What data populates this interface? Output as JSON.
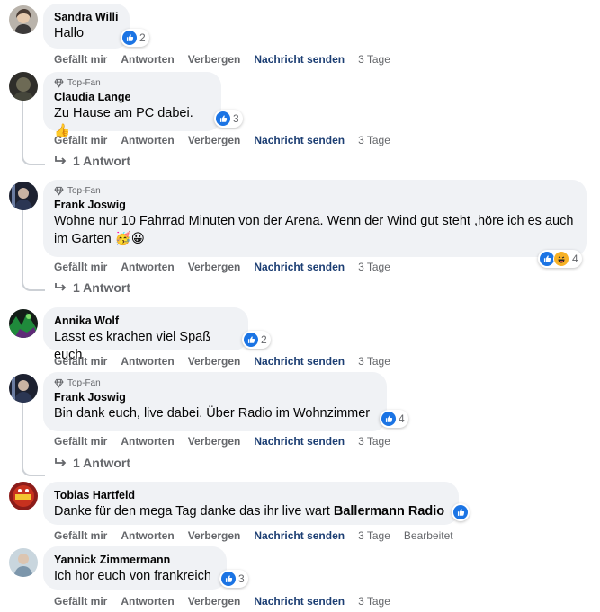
{
  "actions": {
    "like": "Gefällt mir",
    "reply": "Antworten",
    "hide": "Verbergen",
    "message": "Nachricht senden"
  },
  "badge": {
    "top_fan": "Top-Fan"
  },
  "colors": {
    "bubble": "#f0f2f5",
    "like_blue": "#1b74e4",
    "send_link": "#1c3e73",
    "muted": "#65676b"
  },
  "comments": [
    {
      "author": "Sandra Willi",
      "text": "Hallo",
      "reactions": "2",
      "time": "3 Tage",
      "top_fan": false,
      "reaction_icons": [
        "like-icon"
      ]
    },
    {
      "author": "Claudia Lange",
      "text": "Zu Hause am PC dabei. 👍",
      "reactions": "3",
      "time": "3 Tage",
      "top_fan": true,
      "replies": "1 Antwort",
      "reaction_icons": [
        "like-icon"
      ]
    },
    {
      "author": "Frank Joswig",
      "text": "Wohne nur 10 Fahrrad Minuten von der Arena. Wenn der Wind gut steht ,höre ich es auch im Garten 🥳😀",
      "reactions": "4",
      "time": "3 Tage",
      "top_fan": true,
      "replies": "1 Antwort",
      "reaction_icons": [
        "like-icon",
        "haha-icon"
      ]
    },
    {
      "author": "Annika Wolf",
      "text": "Lasst es krachen viel Spaß euch",
      "reactions": "2",
      "time": "3 Tage",
      "top_fan": false,
      "reaction_icons": [
        "like-icon"
      ]
    },
    {
      "author": "Frank Joswig",
      "text": "Bin dank euch, live dabei. Über Radio im Wohnzimmer",
      "reactions": "4",
      "time": "3 Tage",
      "top_fan": true,
      "replies": "1 Antwort",
      "reaction_icons": [
        "like-icon"
      ]
    },
    {
      "author": "Tobias Hartfeld",
      "text_prefix": "Danke für den mega Tag danke das ihr live wart ",
      "text_bold": "Ballermann Radio",
      "time": "3 Tage",
      "edited": "Bearbeitet",
      "top_fan": false,
      "reaction_icons": [
        "like-icon"
      ]
    },
    {
      "author": "Yannick Zimmermann",
      "text": "Ich hor euch von frankreich",
      "reactions": "3",
      "time": "3 Tage",
      "top_fan": false,
      "reaction_icons": [
        "like-icon"
      ]
    }
  ]
}
